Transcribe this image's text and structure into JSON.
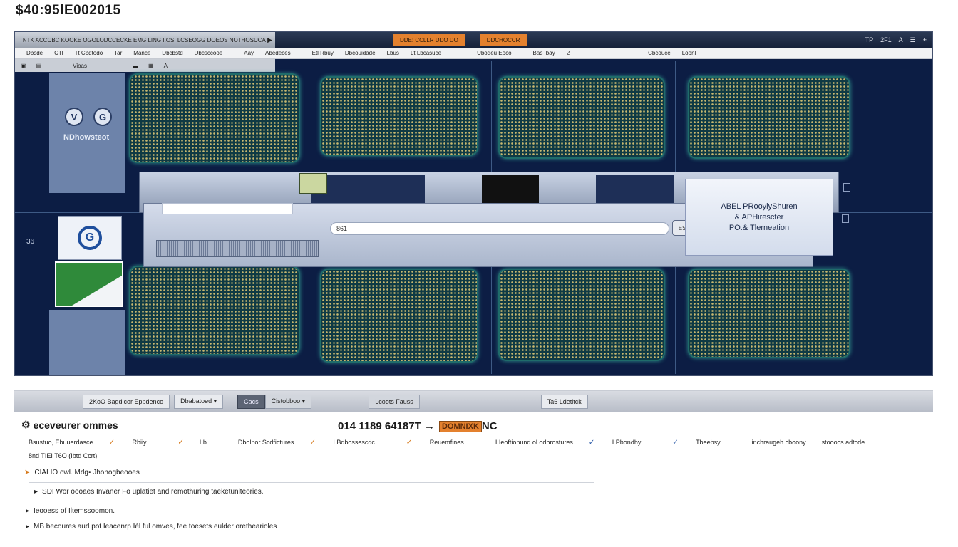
{
  "page_title": "$40:95lE002015",
  "window": {
    "menubar1": {
      "left_text": "TNTK  ACCCBC  KOOKE  OGOLODCCECKE  EMG  LING  I.OS.  LCSEOGG  DOEOS  NOTHOSUCA",
      "tab1": "DDE: CCLLR  DDO  DO",
      "tab2": "DDCHOCCR",
      "controls": [
        "TP",
        "2F1",
        "A",
        "☰",
        "+"
      ]
    },
    "menubar2": [
      "Dbsde",
      "CTl",
      "Tt Cbdtodo",
      "Tar",
      "Mance",
      "Dbcbstd",
      "Dbcsccooe",
      "Aay",
      "Abedeces",
      "Etl Rbuy",
      "Dbcouidade",
      "Lbus",
      "Lt Lbcasuce",
      "Ubodeu Eoco",
      "Bas Ibay",
      "2",
      "Cbcouce",
      "Loonl"
    ],
    "toolbar3": [
      "▣",
      "▤",
      "Vioas",
      "▬",
      "▦",
      "A"
    ],
    "sidepanel_brand": "NDhowsteot",
    "sidepanel_icons": [
      "V",
      "G"
    ],
    "side_number": "36",
    "g_box_letter": "G",
    "search_value": "861",
    "search_button": "ESD",
    "info_panel": [
      "ABEL PRooylyShuren",
      "& APHirescter",
      "PO.& Tlerneation"
    ]
  },
  "taskbar": [
    "2KoO  Bagdicor  Eppdenco",
    "Dbabatoed  ▾",
    "Cacs",
    "Cistobboo  ▾",
    "Lcoots  Fauss",
    "Ta6  Ldetitck"
  ],
  "content": {
    "heading": "eceveurer ommes",
    "bignum": "014 1189  64187T  →",
    "badge": "DOMNIXK",
    "badge_suffix": "NC",
    "row1": [
      "Bsustuo,  Ebuuerdasce",
      "Rbiiy",
      "Lb",
      "Dbolnor  Scdfictures",
      "I  Bdbossescdc",
      "Reuemfines",
      "I Ieoftionund  ol  odbrostures",
      "I  Pbondhy",
      "Tbeebsy",
      "inchraugeh cboony",
      "stooocs  adtcde"
    ],
    "row1b": "8nd  TIEI  T6O  (Ibtd  Ccrt)",
    "line1": "CIAI  IO  owl.  Mdg•  Jhonogbeooes",
    "line2": "SDI  Wor  oooaes  Invaner  Fo  uplatiet  and  remothuring  taeketuniteories.",
    "line3": "Ieooess  of  Iltemssoomon.",
    "line4": "MB  becoures  aud  pot  Ieacenrp  Iél  ful  omves,  fee  toesets  eulder  orethearioles"
  }
}
